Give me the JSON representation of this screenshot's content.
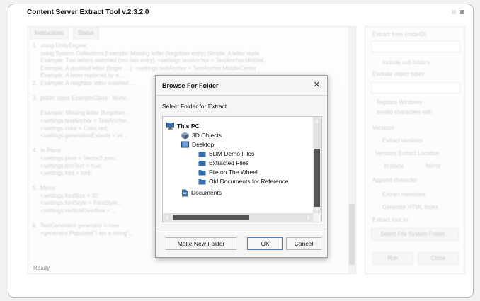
{
  "app": {
    "title": "Content Server Extract Tool v.2.3.2.0"
  },
  "tabs": [
    {
      "label": "Instructions"
    },
    {
      "label": "Status"
    }
  ],
  "instructions_text": "1.  using UnityEngine;\n     using System.Collections;Example: Missing letter (forgotten entry) Simple: A letter repla\n     Example: Two letters switched (too fast entry): <settings.textAnchor = TextAnchor.MiddleL\n     Example: A doubled letter (finger ... ): <settings.textAnchor = TextAnchor.MiddleCenter\n     Example: A letter replaced by a ...\n2.  Example: A neighbor letter inserted ...\n\n3.  public class ExampleClass : Mono...\n\n     Example: Missing letter (forgotten ...\n     <settings.textAnchor = TextAnchor...\n     <settings.color = Color.red;\n     <settings.generationExtents = ve...\n\n4.  In Place\n     <settings.pivot = Vector2.zero;\n     <settings.richText = true;\n     <settings.font = font;\n\n5.  Mirror\n     <settings.fontSize = 32;\n     <settings.fontStyle = FontStyle...\n     <settings.verticalOverflow = ...\n\n6.  TextGenerator generator = new ...\n     <generator.Populate(\"I am a string\"...",
  "right_panel": {
    "extract_from": "Extract from (nodeID)",
    "include_sub_folders": "Include sub folders",
    "exclude_object_types": "Exclude object types",
    "replace_windows": "Replace Windows",
    "invalid_characters_with": "invalid characters with",
    "versions": "Versions",
    "extract_versions": "Extract versions",
    "versions_extract_location": "Versions Extract Location",
    "in_place": "In place",
    "mirror": "Mirror",
    "append_character": "Append character",
    "extract_metadata": "Extract metadata",
    "generate_html_index": "Generate HTML Index",
    "extract_root_to": "Extract root to:",
    "select_button": "Select File System Folder...",
    "run_button": "Run",
    "close_button": "Close"
  },
  "status_bar": {
    "text": "Ready"
  },
  "dialog": {
    "title": "Browse For Folder",
    "subtitle": "Select Folder for Extract",
    "tree": [
      {
        "label": "This PC",
        "icon": "computer-icon"
      },
      {
        "label": "3D Objects",
        "icon": "cube-icon"
      },
      {
        "label": "Desktop",
        "icon": "desktop-folder-icon"
      },
      {
        "label": "BDM Demo Files",
        "icon": "folder-icon"
      },
      {
        "label": "Extracted Files",
        "icon": "folder-icon"
      },
      {
        "label": "File on The Wheel",
        "icon": "folder-icon"
      },
      {
        "label": "Old Documents for Reference",
        "icon": "folder-icon"
      },
      {
        "label": "Documents",
        "icon": "document-icon"
      }
    ],
    "buttons": {
      "new_folder": "Make New Folder",
      "ok": "OK",
      "cancel": "Cancel"
    },
    "close_symbol": "✕"
  },
  "colors": {
    "folder": "#2f6fb3",
    "accent": "#4a7bd0"
  }
}
